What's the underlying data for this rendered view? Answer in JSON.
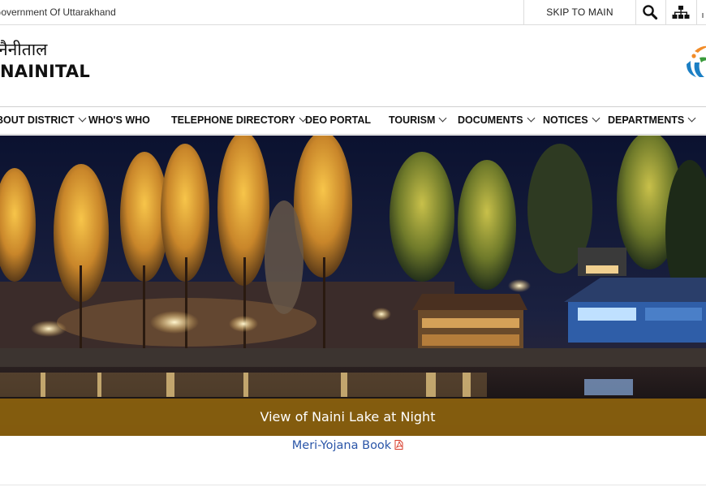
{
  "topbar": {
    "gov_label": "Government Of Uttarakhand",
    "skip_label": "SKIP TO MAIN CONTENT",
    "search_icon": "search-icon",
    "sitemap_icon": "sitemap-icon"
  },
  "header": {
    "title_hindi": "नैनीताल",
    "title_english": "NAINITAL",
    "emblem_icon": "emblem-logo"
  },
  "nav": {
    "items": [
      {
        "label": "ABOUT DISTRICT",
        "has_dropdown": true
      },
      {
        "label": "WHO'S WHO",
        "has_dropdown": false
      },
      {
        "label": "TELEPHONE DIRECTORY",
        "has_dropdown": true
      },
      {
        "label": "DEO PORTAL",
        "has_dropdown": false
      },
      {
        "label": "TOURISM",
        "has_dropdown": true
      },
      {
        "label": "DOCUMENTS",
        "has_dropdown": true
      },
      {
        "label": "NOTICES",
        "has_dropdown": true
      },
      {
        "label": "DEPARTMENTS",
        "has_dropdown": true
      }
    ]
  },
  "hero": {
    "caption": "View of Naini Lake at Night",
    "caption_color": "#8c620e"
  },
  "links": {
    "yojana_label": "Meri-Yojana Book",
    "pdf_icon": "pdf-icon",
    "link_color": "#2b56a8"
  }
}
